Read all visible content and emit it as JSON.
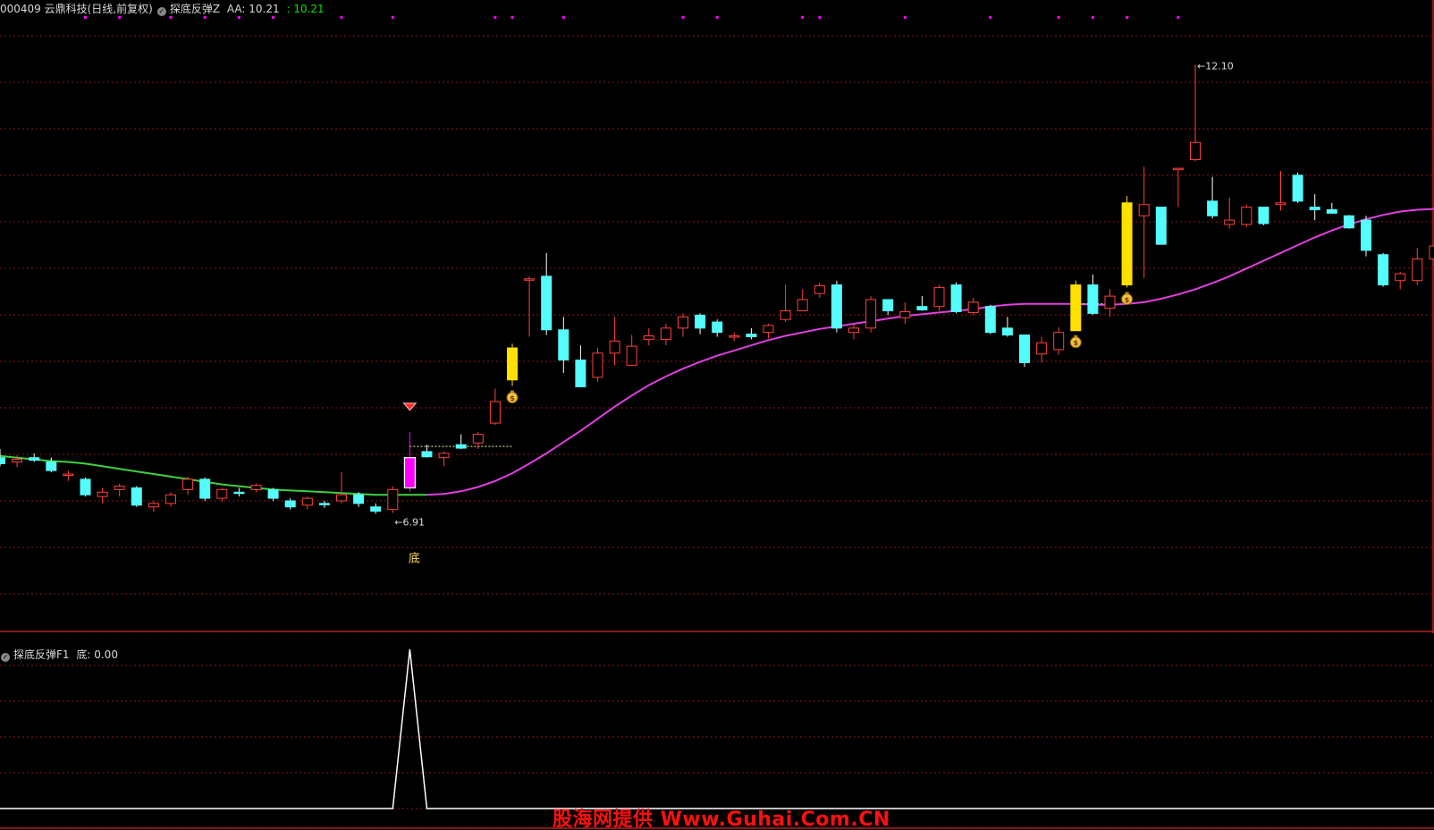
{
  "header": {
    "code_name": "000409 云鼎科技(日线,前复权)",
    "indicator_name": "探底反弹Z",
    "aa_label": "AA: 10.21",
    "aa_value": ": 10.21"
  },
  "sub_header": {
    "indicator_name": "探底反弹F1",
    "value_label": "底: 0.00"
  },
  "annotations": {
    "high_label": "12.10",
    "low_label": "6.91",
    "signal_label": "底"
  },
  "watermark": "股海网提供 Www.Guhai.Com.CN",
  "colors": {
    "background": "#000000",
    "up_candle": "#ff4040",
    "down_candle": "#54fcfc",
    "signal_candle": "#ffe000",
    "bottom_candle": "#ff00ff",
    "ma_line_after": "#e040e0",
    "ma_line_before": "#40d040",
    "grid": "#8b1a1a",
    "dots": "#ff00ff",
    "watermark": "#ff1010"
  },
  "icons": {
    "signal_marker": "money-bag-icon",
    "bottom_marker": "red-gem-icon"
  },
  "chart_data": [
    {
      "type": "candlestick",
      "title": "000409 云鼎科技(日线,前复权)",
      "xlabel": "",
      "ylabel": "",
      "ylim": [
        5.6,
        12.6
      ],
      "grid": true,
      "candles": [
        {
          "o": 7.55,
          "h": 7.65,
          "l": 7.45,
          "c": 7.48
        },
        {
          "o": 7.5,
          "h": 7.58,
          "l": 7.44,
          "c": 7.53
        },
        {
          "o": 7.55,
          "h": 7.6,
          "l": 7.5,
          "c": 7.52
        },
        {
          "o": 7.5,
          "h": 7.55,
          "l": 7.38,
          "c": 7.4
        },
        {
          "o": 7.35,
          "h": 7.4,
          "l": 7.28,
          "c": 7.36
        },
        {
          "o": 7.3,
          "h": 7.32,
          "l": 7.1,
          "c": 7.12
        },
        {
          "o": 7.1,
          "h": 7.2,
          "l": 7.02,
          "c": 7.15
        },
        {
          "o": 7.18,
          "h": 7.25,
          "l": 7.1,
          "c": 7.22
        },
        {
          "o": 7.2,
          "h": 7.22,
          "l": 6.98,
          "c": 7.0
        },
        {
          "o": 6.98,
          "h": 7.05,
          "l": 6.92,
          "c": 7.02
        },
        {
          "o": 7.02,
          "h": 7.15,
          "l": 6.98,
          "c": 7.12
        },
        {
          "o": 7.18,
          "h": 7.33,
          "l": 7.12,
          "c": 7.3
        },
        {
          "o": 7.3,
          "h": 7.32,
          "l": 7.05,
          "c": 7.08
        },
        {
          "o": 7.08,
          "h": 7.2,
          "l": 7.04,
          "c": 7.18
        },
        {
          "o": 7.15,
          "h": 7.2,
          "l": 7.1,
          "c": 7.14
        },
        {
          "o": 7.18,
          "h": 7.25,
          "l": 7.15,
          "c": 7.23
        },
        {
          "o": 7.18,
          "h": 7.2,
          "l": 7.05,
          "c": 7.08
        },
        {
          "o": 7.05,
          "h": 7.08,
          "l": 6.95,
          "c": 6.98
        },
        {
          "o": 7.0,
          "h": 7.1,
          "l": 6.95,
          "c": 7.08
        },
        {
          "o": 7.02,
          "h": 7.05,
          "l": 6.97,
          "c": 7.01
        },
        {
          "o": 7.05,
          "h": 7.38,
          "l": 7.02,
          "c": 7.12
        },
        {
          "o": 7.12,
          "h": 7.15,
          "l": 6.98,
          "c": 7.02
        },
        {
          "o": 6.98,
          "h": 7.02,
          "l": 6.9,
          "c": 6.93
        },
        {
          "o": 6.95,
          "h": 7.22,
          "l": 6.91,
          "c": 7.18,
          "marker": "low"
        },
        {
          "o": 7.2,
          "h": 7.85,
          "l": 7.15,
          "c": 7.55,
          "signal": "bottom"
        },
        {
          "o": 7.62,
          "h": 7.7,
          "l": 7.55,
          "c": 7.56
        },
        {
          "o": 7.55,
          "h": 7.62,
          "l": 7.45,
          "c": 7.6
        },
        {
          "o": 7.7,
          "h": 7.82,
          "l": 7.65,
          "c": 7.66
        },
        {
          "o": 7.72,
          "h": 7.85,
          "l": 7.65,
          "c": 7.82
        },
        {
          "o": 7.95,
          "h": 8.35,
          "l": 7.93,
          "c": 8.2
        },
        {
          "o": 8.45,
          "h": 8.87,
          "l": 8.38,
          "c": 8.82,
          "signal": "buy"
        },
        {
          "o": 9.62,
          "h": 9.65,
          "l": 8.95,
          "c": 9.62
        },
        {
          "o": 9.65,
          "h": 9.92,
          "l": 8.97,
          "c": 9.03
        },
        {
          "o": 9.03,
          "h": 9.18,
          "l": 8.53,
          "c": 8.68
        },
        {
          "o": 8.68,
          "h": 8.85,
          "l": 8.38,
          "c": 8.37
        },
        {
          "o": 8.48,
          "h": 8.82,
          "l": 8.43,
          "c": 8.76
        },
        {
          "o": 8.76,
          "h": 9.18,
          "l": 8.62,
          "c": 8.9
        },
        {
          "o": 8.62,
          "h": 8.97,
          "l": 8.62,
          "c": 8.84
        },
        {
          "o": 8.92,
          "h": 9.05,
          "l": 8.85,
          "c": 8.96
        },
        {
          "o": 8.92,
          "h": 9.1,
          "l": 8.85,
          "c": 9.05
        },
        {
          "o": 9.05,
          "h": 9.22,
          "l": 8.95,
          "c": 9.18
        },
        {
          "o": 9.2,
          "h": 9.22,
          "l": 8.98,
          "c": 9.05
        },
        {
          "o": 9.12,
          "h": 9.15,
          "l": 8.95,
          "c": 9.0
        },
        {
          "o": 8.95,
          "h": 9.0,
          "l": 8.9,
          "c": 8.96
        },
        {
          "o": 8.98,
          "h": 9.05,
          "l": 8.92,
          "c": 8.95
        },
        {
          "o": 9.0,
          "h": 9.1,
          "l": 8.93,
          "c": 9.08
        },
        {
          "o": 9.15,
          "h": 9.55,
          "l": 9.12,
          "c": 9.25
        },
        {
          "o": 9.25,
          "h": 9.5,
          "l": 9.25,
          "c": 9.38
        },
        {
          "o": 9.45,
          "h": 9.58,
          "l": 9.4,
          "c": 9.54
        },
        {
          "o": 9.55,
          "h": 9.6,
          "l": 9.0,
          "c": 9.05
        },
        {
          "o": 9.0,
          "h": 9.1,
          "l": 8.92,
          "c": 9.05
        },
        {
          "o": 9.05,
          "h": 9.42,
          "l": 9.0,
          "c": 9.38
        },
        {
          "o": 9.38,
          "h": 9.38,
          "l": 9.2,
          "c": 9.25
        },
        {
          "o": 9.17,
          "h": 9.35,
          "l": 9.1,
          "c": 9.24
        },
        {
          "o": 9.3,
          "h": 9.42,
          "l": 9.25,
          "c": 9.26
        },
        {
          "o": 9.3,
          "h": 9.55,
          "l": 9.25,
          "c": 9.52
        },
        {
          "o": 9.55,
          "h": 9.58,
          "l": 9.22,
          "c": 9.24
        },
        {
          "o": 9.23,
          "h": 9.4,
          "l": 9.2,
          "c": 9.35
        },
        {
          "o": 9.3,
          "h": 9.32,
          "l": 8.98,
          "c": 9.0
        },
        {
          "o": 9.05,
          "h": 9.18,
          "l": 8.95,
          "c": 8.97
        },
        {
          "o": 8.97,
          "h": 8.97,
          "l": 8.6,
          "c": 8.65
        },
        {
          "o": 8.75,
          "h": 8.95,
          "l": 8.65,
          "c": 8.88
        },
        {
          "o": 8.8,
          "h": 9.06,
          "l": 8.74,
          "c": 9.0
        },
        {
          "o": 9.02,
          "h": 9.6,
          "l": 9.02,
          "c": 9.55,
          "signal": "buy"
        },
        {
          "o": 9.55,
          "h": 9.67,
          "l": 9.2,
          "c": 9.22
        },
        {
          "o": 9.28,
          "h": 9.5,
          "l": 9.18,
          "c": 9.42
        },
        {
          "o": 9.55,
          "h": 10.58,
          "l": 9.52,
          "c": 10.5,
          "signal": "buy"
        },
        {
          "o": 10.35,
          "h": 10.92,
          "l": 9.63,
          "c": 10.48
        },
        {
          "o": 10.45,
          "h": 10.45,
          "l": 10.02,
          "c": 10.02
        },
        {
          "o": 10.9,
          "h": 10.9,
          "l": 10.45,
          "c": 10.9
        },
        {
          "o": 11.0,
          "h": 12.1,
          "l": 10.98,
          "c": 11.2,
          "marker": "high"
        },
        {
          "o": 10.52,
          "h": 10.8,
          "l": 10.32,
          "c": 10.35
        },
        {
          "o": 10.25,
          "h": 10.56,
          "l": 10.2,
          "c": 10.3
        },
        {
          "o": 10.25,
          "h": 10.48,
          "l": 10.22,
          "c": 10.45
        },
        {
          "o": 10.45,
          "h": 10.45,
          "l": 10.24,
          "c": 10.26
        },
        {
          "o": 10.48,
          "h": 10.87,
          "l": 10.41,
          "c": 10.5
        },
        {
          "o": 10.82,
          "h": 10.85,
          "l": 10.5,
          "c": 10.52
        },
        {
          "o": 10.45,
          "h": 10.6,
          "l": 10.3,
          "c": 10.42
        },
        {
          "o": 10.42,
          "h": 10.5,
          "l": 10.38,
          "c": 10.38
        },
        {
          "o": 10.35,
          "h": 10.36,
          "l": 10.2,
          "c": 10.21
        },
        {
          "o": 10.3,
          "h": 10.35,
          "l": 9.88,
          "c": 9.95
        },
        {
          "o": 9.9,
          "h": 9.92,
          "l": 9.53,
          "c": 9.55
        },
        {
          "o": 9.6,
          "h": 9.7,
          "l": 9.5,
          "c": 9.68
        },
        {
          "o": 9.6,
          "h": 9.98,
          "l": 9.55,
          "c": 9.85
        },
        {
          "o": 9.85,
          "h": 10.05,
          "l": 9.78,
          "c": 10.0
        }
      ],
      "ma_line": [
        7.57,
        7.55,
        7.53,
        7.51,
        7.5,
        7.48,
        7.45,
        7.42,
        7.39,
        7.36,
        7.33,
        7.3,
        7.27,
        7.24,
        7.22,
        7.2,
        7.18,
        7.17,
        7.16,
        7.15,
        7.14,
        7.13,
        7.12,
        7.12,
        7.12,
        7.12,
        7.13,
        7.16,
        7.21,
        7.28,
        7.37,
        7.48,
        7.6,
        7.73,
        7.86,
        8.0,
        8.14,
        8.27,
        8.39,
        8.49,
        8.58,
        8.66,
        8.73,
        8.79,
        8.85,
        8.91,
        8.96,
        9.0,
        9.04,
        9.07,
        9.1,
        9.13,
        9.16,
        9.19,
        9.21,
        9.23,
        9.25,
        9.27,
        9.3,
        9.32,
        9.33,
        9.33,
        9.33,
        9.33,
        9.32,
        9.32,
        9.33,
        9.35,
        9.39,
        9.44,
        9.5,
        9.57,
        9.65,
        9.74,
        9.83,
        9.92,
        10.01,
        10.1,
        10.18,
        10.25,
        10.31,
        10.36,
        10.4,
        10.42,
        10.43
      ]
    },
    {
      "type": "line",
      "title": "探底反弹F1",
      "series": [
        {
          "name": "底",
          "values": [
            0,
            0,
            0,
            0,
            0,
            0,
            0,
            0,
            0,
            0,
            0,
            0,
            0,
            0,
            0,
            0,
            0,
            0,
            0,
            0,
            0,
            0,
            0,
            0,
            1,
            0,
            0,
            0,
            0,
            0,
            0,
            0,
            0,
            0,
            0,
            0,
            0,
            0,
            0,
            0,
            0,
            0,
            0,
            0,
            0,
            0,
            0,
            0,
            0,
            0,
            0,
            0,
            0,
            0,
            0,
            0,
            0,
            0,
            0,
            0,
            0,
            0,
            0,
            0,
            0,
            0,
            0,
            0,
            0,
            0,
            0,
            0,
            0,
            0,
            0,
            0,
            0,
            0,
            0,
            0,
            0,
            0,
            0,
            0,
            0
          ]
        }
      ],
      "ylim": [
        0,
        1
      ],
      "grid": true
    }
  ],
  "top_dots_index": [
    5,
    7,
    10,
    12,
    14,
    16,
    20,
    23,
    29,
    30,
    33,
    40,
    42,
    47,
    48,
    53,
    58,
    62,
    64,
    66,
    69
  ]
}
